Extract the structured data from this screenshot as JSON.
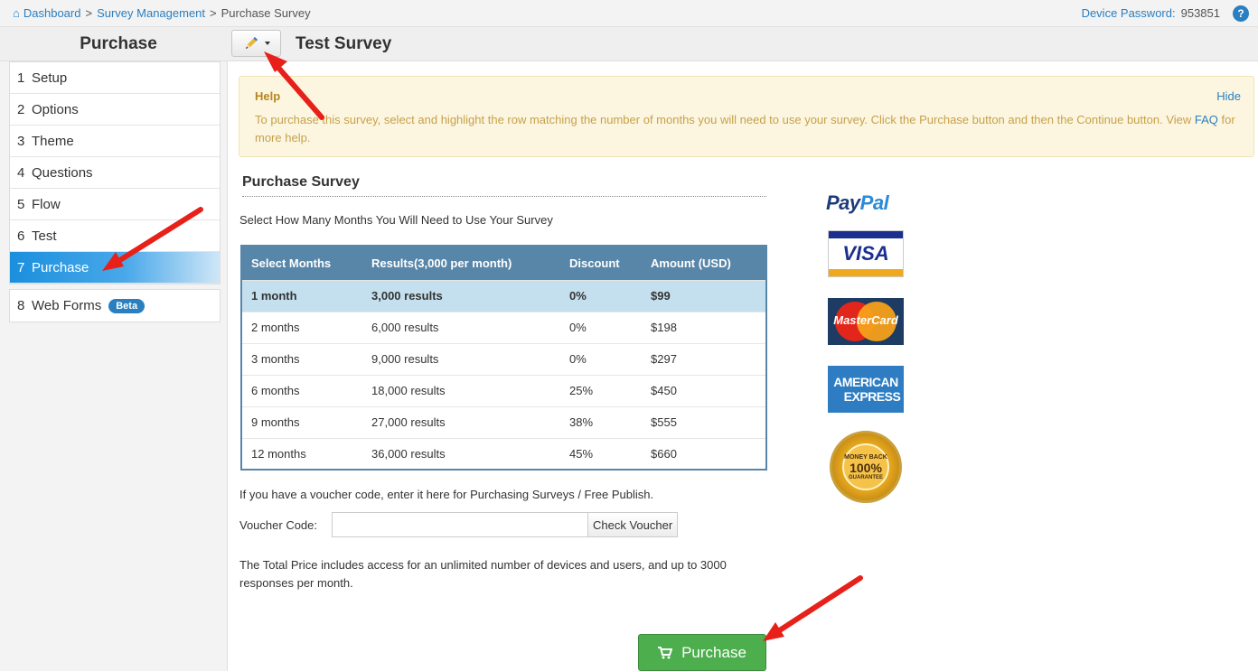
{
  "breadcrumb": {
    "items": [
      "Dashboard",
      "Survey Management"
    ],
    "separator": ">",
    "current": "Purchase Survey"
  },
  "device_password": {
    "label": "Device Password:",
    "value": "953851"
  },
  "header": {
    "panel_title": "Purchase",
    "survey_title": "Test Survey"
  },
  "sidebar": {
    "steps": [
      {
        "num": "1",
        "label": "Setup"
      },
      {
        "num": "2",
        "label": "Options"
      },
      {
        "num": "3",
        "label": "Theme"
      },
      {
        "num": "4",
        "label": "Questions"
      },
      {
        "num": "5",
        "label": "Flow"
      },
      {
        "num": "6",
        "label": "Test"
      },
      {
        "num": "7",
        "label": "Purchase"
      }
    ],
    "active_step": "7",
    "web_forms": {
      "num": "8",
      "label": "Web Forms",
      "badge": "Beta"
    }
  },
  "help": {
    "title": "Help",
    "hide": "Hide",
    "text": "To purchase this survey, select and highlight the row matching the number of months you will need to use your survey. Click the Purchase button and then the Continue button. View",
    "faq": "FAQ",
    "text_end": "for more help."
  },
  "purchase": {
    "title": "Purchase Survey",
    "instruction": "Select How Many Months You Will Need to Use Your Survey",
    "table": {
      "headers": [
        "Select Months",
        "Results(3,000 per month)",
        "Discount",
        "Amount (USD)"
      ],
      "rows": [
        [
          "1 month",
          "3,000 results",
          "0%",
          "$99"
        ],
        [
          "2 months",
          "6,000 results",
          "0%",
          "$198"
        ],
        [
          "3 months",
          "9,000 results",
          "0%",
          "$297"
        ],
        [
          "6 months",
          "18,000 results",
          "25%",
          "$450"
        ],
        [
          "9 months",
          "27,000 results",
          "38%",
          "$555"
        ],
        [
          "12 months",
          "36,000 results",
          "45%",
          "$660"
        ]
      ],
      "selected_row": 0
    },
    "voucher_note": "If you have a voucher code, enter it here for Purchasing Surveys / Free Publish.",
    "voucher_label": "Voucher Code:",
    "voucher_value": "",
    "voucher_button": "Check Voucher",
    "total_note": "The Total Price includes access for an unlimited number of devices and users, and up to 3000 responses per month.",
    "purchase_button": "Purchase"
  },
  "payment_logos": {
    "paypal": [
      "Pay",
      "Pal"
    ],
    "visa": "VISA",
    "mastercard": "MasterCard",
    "amex": [
      "AMERICAN",
      "EXPRESS"
    ],
    "guarantee": [
      "MONEY BACK",
      "100%",
      "GUARANTEE"
    ]
  },
  "colors": {
    "link": "#2a7fc0",
    "table_header": "#5886a9",
    "selected_row": "#c4dfee",
    "active_step": "#1a8fdd",
    "purchase_button": "#4cae4c",
    "annotation_arrow": "#e8201a"
  }
}
